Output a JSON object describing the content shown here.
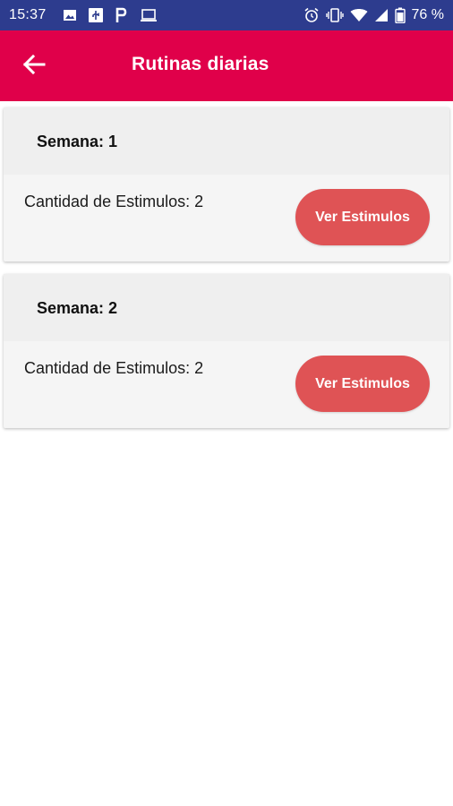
{
  "status_bar": {
    "time": "15:37",
    "battery_text": "76 %",
    "left_icons": [
      "image-icon",
      "usb-icon",
      "p-app-icon",
      "laptop-icon"
    ],
    "right_icons": [
      "alarm-icon",
      "vibrate-icon",
      "wifi-icon",
      "signal-icon",
      "battery-icon"
    ]
  },
  "app_bar": {
    "title": "Rutinas diarias",
    "back_icon": "arrow-left-icon",
    "background": "#e0004a"
  },
  "weeks": [
    {
      "label": "Semana: 1",
      "count_text": "Cantidad de Estimulos: 2",
      "button_label": "Ver Estimulos"
    },
    {
      "label": "Semana: 2",
      "count_text": "Cantidad de Estimulos: 2",
      "button_label": "Ver Estimulos"
    }
  ],
  "colors": {
    "status_bar": "#2d3c8e",
    "accent_button": "#df5355"
  }
}
